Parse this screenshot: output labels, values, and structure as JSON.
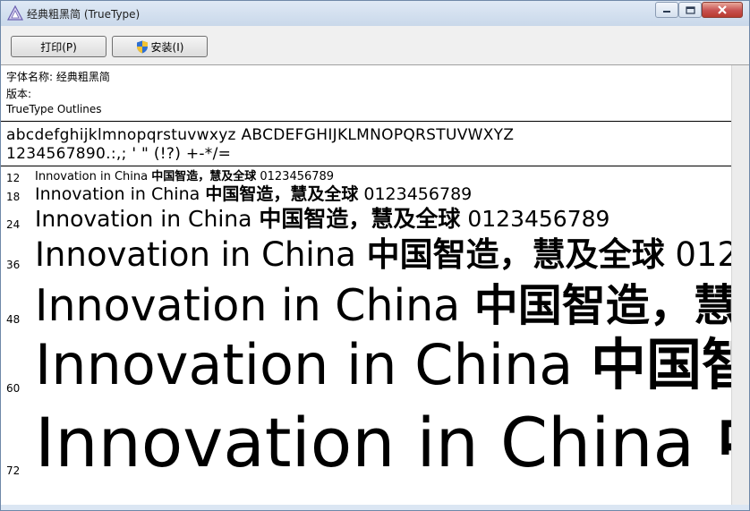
{
  "window": {
    "title": "经典粗黑简 (TrueType)",
    "icon": "font-file-icon",
    "controls": [
      "minimize-icon",
      "maximize-icon",
      "close-icon"
    ]
  },
  "toolbar": {
    "print_label": "打印(P)",
    "install_label": "安装(I)",
    "install_icon": "uac-shield-icon"
  },
  "info": {
    "font_name": "字体名称: 经典粗黑简",
    "version": "版本:",
    "outline": "TrueType Outlines"
  },
  "charset": {
    "line1": "abcdefghijklmnopqrstuvwxyz ABCDEFGHIJKLMNOPQRSTUVWXYZ",
    "line2": "1234567890.:,; ' \" (!?) +-*/="
  },
  "samples": {
    "text_en": "Innovation in China ",
    "text_cn": "中国智造，慧及全球",
    "text_num": " 0123456789",
    "sizes": [
      "12",
      "18",
      "24",
      "36",
      "48",
      "60",
      "72"
    ]
  },
  "colors": {
    "frame": "#dbe6f3",
    "close_button": "#c75050",
    "toolbar": "#f0f0f0",
    "content": "#ffffff"
  }
}
